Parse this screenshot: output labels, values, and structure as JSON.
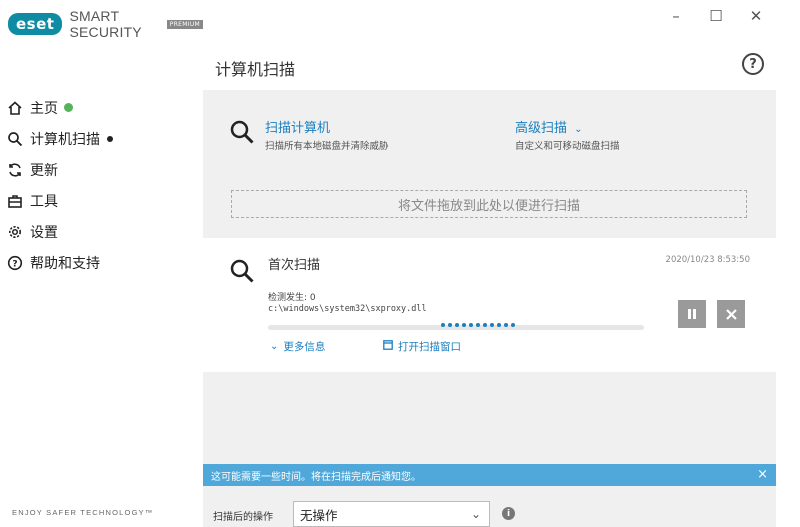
{
  "app": {
    "brand_badge": "eset",
    "brand_name": "SMART SECURITY",
    "brand_edition": "PREMIUM",
    "tagline": "ENJOY SAFER TECHNOLOGY™"
  },
  "window_controls": {
    "minimize": "–",
    "maximize": "☐",
    "close": "✕"
  },
  "sidebar": {
    "items": [
      {
        "label": "主页",
        "icon": "home-icon"
      },
      {
        "label": "计算机扫描",
        "icon": "search-icon"
      },
      {
        "label": "更新",
        "icon": "refresh-icon"
      },
      {
        "label": "工具",
        "icon": "toolbox-icon"
      },
      {
        "label": "设置",
        "icon": "gear-icon"
      },
      {
        "label": "帮助和支持",
        "icon": "help-circle-icon"
      }
    ]
  },
  "header": {
    "title": "计算机扫描",
    "help": "?"
  },
  "scan_options": {
    "computer": {
      "title": "扫描计算机",
      "desc": "扫描所有本地磁盘并清除威胁"
    },
    "advanced": {
      "title": "高级扫描",
      "desc": "自定义和可移动磁盘扫描"
    }
  },
  "dropzone": {
    "text": "将文件拖放到此处以便进行扫描"
  },
  "scan_card": {
    "title": "首次扫描",
    "timestamp": "2020/10/23 8:53:50",
    "detections": "检测发生: 0",
    "current_file": "c:\\windows\\system32\\sxproxy.dll",
    "more_info": "更多信息",
    "open_window": "打开扫描窗口"
  },
  "notice": {
    "text": "这可能需要一些时间。将在扫描完成后通知您。",
    "close": "×"
  },
  "after_scan": {
    "label": "扫描后的操作",
    "value": "无操作"
  },
  "colors": {
    "accent": "#1b7fbf",
    "notice": "#4fa8d9",
    "brand": "#0d8ca3",
    "status_ok": "#55b35a"
  }
}
